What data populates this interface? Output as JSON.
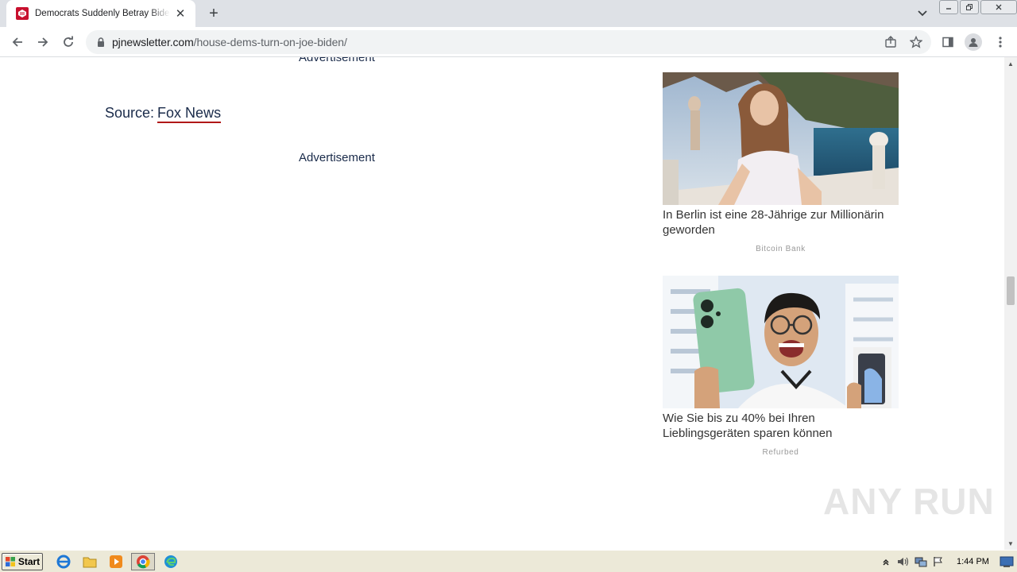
{
  "browser": {
    "tab": {
      "title": "Democrats Suddenly Betray Biden over",
      "favicon": "pjnewsletter-favicon"
    },
    "new_tab_label": "+",
    "tab_close_label": "✕",
    "url": {
      "domain": "pjnewsletter.com",
      "path": "/house-dems-turn-on-joe-biden/"
    }
  },
  "page": {
    "ad_label_top": "Advertisement",
    "source_label": "Source:",
    "source_link": "Fox News",
    "ad_label_mid": "Advertisement",
    "accent_color": "#b01818",
    "cards": [
      {
        "headline": "In Berlin ist eine 28-Jährige zur Millionärin geworden",
        "brand": "Bitcoin Bank",
        "image": "woman-on-terrace-photo"
      },
      {
        "headline": "Wie Sie bis zu 40% bei Ihren Lieblingsgeräten sparen können",
        "brand": "Refurbed",
        "image": "man-holding-phones-photo"
      }
    ]
  },
  "watermark": "ANY RUN",
  "taskbar": {
    "start_label": "Start",
    "clock": "1:44 PM"
  }
}
